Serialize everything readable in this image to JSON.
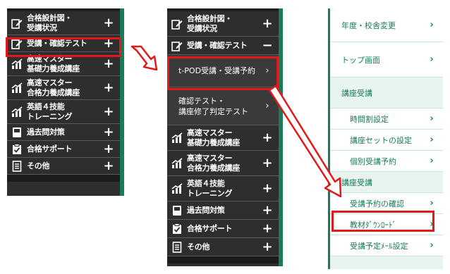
{
  "panel1": {
    "items": [
      {
        "label": "合格設計図・\n受講状況",
        "icon": "edit-icon",
        "toggle": "+"
      },
      {
        "label": "受講・確認テスト",
        "icon": "edit-icon",
        "toggle": "+"
      },
      {
        "label": "高速マスター\n基礎力養成講座",
        "icon": "chart-icon",
        "toggle": "+"
      },
      {
        "label": "高速マスター\n合格力養成講座",
        "icon": "chart-icon",
        "toggle": "+"
      },
      {
        "label": "英語４技能\nトレーニング",
        "icon": "chart-icon",
        "toggle": "+"
      },
      {
        "label": "過去問対策",
        "icon": "book-icon",
        "toggle": "+"
      },
      {
        "label": "合格サポート",
        "icon": "clipboard-check-icon",
        "toggle": "+"
      },
      {
        "label": "その他",
        "icon": "document-icon",
        "toggle": "+"
      }
    ]
  },
  "panel2": {
    "items_top": [
      {
        "label": "合格設計図・\n受講状況",
        "icon": "edit-icon",
        "toggle": "+"
      },
      {
        "label": "受講・確認テスト",
        "icon": "edit-icon",
        "toggle": "−"
      }
    ],
    "sub_items": [
      {
        "label": "t-POD受講・受講予約",
        "chevron": "›"
      },
      {
        "label": "確認テスト・\n講座修了判定テスト",
        "chevron": "›"
      }
    ],
    "items_bottom": [
      {
        "label": "高速マスター\n基礎力養成講座",
        "icon": "chart-icon",
        "toggle": "+"
      },
      {
        "label": "高速マスター\n合格力養成講座",
        "icon": "chart-icon",
        "toggle": "+"
      },
      {
        "label": "英語４技能\nトレーニング",
        "icon": "chart-icon",
        "toggle": "+"
      },
      {
        "label": "過去問対策",
        "icon": "book-icon",
        "toggle": "+"
      },
      {
        "label": "合格サポート",
        "icon": "clipboard-check-icon",
        "toggle": "+"
      },
      {
        "label": "その他",
        "icon": "document-icon",
        "toggle": "+"
      }
    ]
  },
  "panel3": {
    "items": [
      {
        "label": "年度・校舎変更",
        "chevron": "›"
      },
      {
        "label": "トップ画面",
        "chevron": "›"
      },
      {
        "label": "講座受講",
        "chevron": ""
      },
      {
        "label": "時間割設定",
        "chevron": "›"
      },
      {
        "label": "講座セットの設定",
        "chevron": "›"
      },
      {
        "label": "個別受講予約",
        "chevron": "›"
      },
      {
        "label": "講座受講",
        "chevron": ""
      },
      {
        "label": "受講予約の確認",
        "chevron": "›"
      },
      {
        "label": "教材ﾀﾞｳﾝﾛｰﾄﾞ",
        "chevron": "›"
      },
      {
        "label": "受講予定ﾒｰﾙ設定",
        "chevron": "›"
      }
    ]
  },
  "colors": {
    "menu_bg": "#2e2e2e",
    "accent_green": "#1a7a5a",
    "highlight_red": "#e01a1a",
    "light_green_bg": "#e8f5ee"
  }
}
